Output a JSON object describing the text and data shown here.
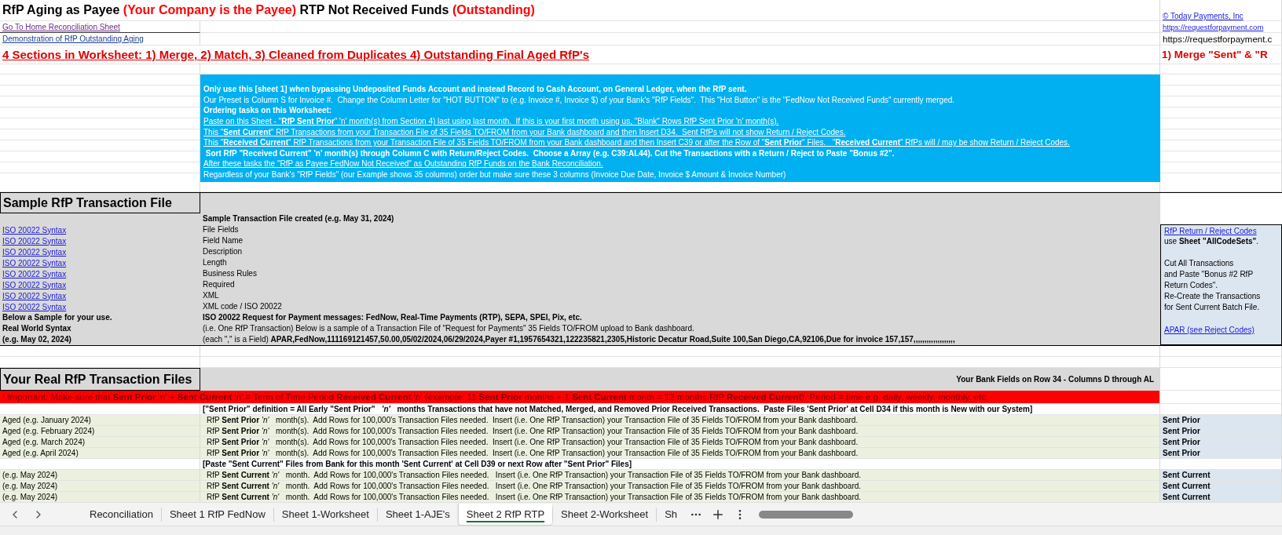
{
  "header": {
    "title": [
      {
        "text": "RfP Aging as Payee ",
        "color": "#000000"
      },
      {
        "text": "(Your Company is the Payee)",
        "color": "#ff0000"
      },
      {
        "text": " RTP Not Received Funds ",
        "color": "#000000"
      },
      {
        "text": "(Outstanding)",
        "color": "#ff0000"
      }
    ],
    "home_link": "Go To Home Reconciliation Sheet",
    "demo_link": "Demonstration of RfP Outstanding Aging",
    "sections_heading": "4 Sections in Worksheet: 1) Merge, 2) Match, 3) Cleaned from Duplicates 4) Outstanding Final Aged RfP's",
    "copyright_link": "© Today Payments, Inc",
    "site_link": "https://requestforpayment.com",
    "site_text": "https://requestforpayment.c",
    "merge_heading": "1) Merge \"Sent\" & \"R"
  },
  "instructions": [
    {
      "kind": "bold",
      "text": "Only use this [sheet 1] when bypassing Undeposited Funds Account and instead Record to Cash Account, on General Ledger, when the RfP sent."
    },
    {
      "kind": "plain",
      "text": "Our Preset is Column S for Invoice #.  Change the Column Letter for \"HOT BUTTON\" to (e.g. Invoice #, Invoice $) of your Bank's \"RfP Fields\".  This \"Hot Button\" is the \"FedNow Not Received Funds\" currently merged."
    },
    {
      "kind": "bold",
      "text": "Ordering tasks on this Worksheet:"
    },
    {
      "kind": "link",
      "text": "Paste on this Sheet - \"**RfP Sent Prior**\" 'n' month(s) from Section 4) last using last month.  If this is your first month using us, \"Blank\" Rows RfP Sent Prior 'n' month(s)."
    },
    {
      "kind": "link",
      "text": "This \"**Sent Current**\" RfP Transactions from your Transaction File of 35 Fields TO/FROM from your Bank dashboard and then Insert D34.  Sent RfPs will not show Return / Reject Codes."
    },
    {
      "kind": "link",
      "text": "This \"**Received Current**\" RfP Transactions from your Transaction File of 35 Fields TO/FROM from your Bank dashboard and then Insert C39 or after the Row of \"**Sent Prior**\" Files.   \"**Received Current**\" RfPs will / may be show Return / Reject Codes."
    },
    {
      "kind": "bold",
      "text": " Sort RfP \"Received Current\" 'n' month(s) through Column C with Return/Reject Codes.  Choose a Array (e.g. C39:AL44). Cut the Transactions with a Return / Reject to Paste \"Bonus #2\"."
    },
    {
      "kind": "link",
      "text": "After these tasks the \"RfP as Payee FedNow Not Received\" as Outstanding RfP Funds on the Bank Reconciliation."
    },
    {
      "kind": "plain",
      "text": "Regardless of your Bank's \"RfP Fields\" (our Example shows 35 columns) order but make sure these 3 columns (Invoice Due Date, Invoice $ Amount & Invoice Number)"
    }
  ],
  "sample": {
    "title": "Sample RfP Transaction File",
    "rows": [
      {
        "value": {
          "kind": "bold",
          "text": "Sample Transaction File created (e.g. May 31, 2024)"
        }
      },
      {
        "label": {
          "kind": "link",
          "text": "ISO 20022 Syntax"
        },
        "value": {
          "kind": "plain",
          "text": "File Fields"
        }
      },
      {
        "label": {
          "kind": "link",
          "text": "ISO 20022 Syntax"
        },
        "value": {
          "kind": "plain",
          "text": "Field Name"
        }
      },
      {
        "label": {
          "kind": "link",
          "text": "ISO 20022 Syntax"
        },
        "value": {
          "kind": "plain",
          "text": "Description"
        }
      },
      {
        "label": {
          "kind": "link",
          "text": "ISO 20022 Syntax"
        },
        "value": {
          "kind": "plain",
          "text": "Length"
        }
      },
      {
        "label": {
          "kind": "link",
          "text": "ISO 20022 Syntax"
        },
        "value": {
          "kind": "plain",
          "text": "Business Rules"
        }
      },
      {
        "label": {
          "kind": "link",
          "text": "ISO 20022 Syntax"
        },
        "value": {
          "kind": "plain",
          "text": "Required"
        }
      },
      {
        "label": {
          "kind": "link",
          "text": "ISO 20022 Syntax"
        },
        "value": {
          "kind": "plain",
          "text": "XML"
        }
      },
      {
        "label": {
          "kind": "link",
          "text": "ISO 20022 Syntax"
        },
        "value": {
          "kind": "plain",
          "text": "XML code / ISO 20022"
        }
      },
      {
        "label": {
          "kind": "bold",
          "text": "Below a Sample for your use."
        },
        "value": {
          "kind": "bold",
          "text": "ISO 20022 Request for Payment messages: FedNow, Real-Time Payments (RTP), SEPA, SPEI, Pix, etc."
        }
      },
      {
        "label": {
          "kind": "bold",
          "text": "Real World Syntax"
        },
        "value": {
          "kind": "plain",
          "text": "(i.e. One RfP Transaction) Below is a sample of a Transaction File of \"Request for Payments\" 35 Fields TO/FROM upload to Bank dashboard."
        }
      },
      {
        "label": {
          "kind": "bold",
          "text": "(e.g. May 02, 2024)"
        },
        "value": {
          "kind": "plain",
          "text": "(each \",\" is a Field) **APAR,FedNow,111169121457,50.00,05/02/2024,06/29/2024,Payer #1,1957654321,122235821,2305,Historic Decatur Road,Suite 100,San Diego,CA,92106,Due for invoice 157,157,,,,,,,,,,,,,,,,,,,**"
        }
      }
    ],
    "side": [
      {
        "kind": "link",
        "text": "RfP Return / Reject Codes"
      },
      {
        "kind": "plain",
        "text": "use **Sheet \"AllCodeSets\"**."
      },
      {
        "kind": "blank"
      },
      {
        "kind": "plain",
        "text": "Cut All Transactions"
      },
      {
        "kind": "plain",
        "text": "and Paste \"Bonus #2 RfP"
      },
      {
        "kind": "plain",
        "text": "Return Codes\"."
      },
      {
        "kind": "plain",
        "text": "Re-Create the Transactions"
      },
      {
        "kind": "plain",
        "text": "for Sent Current Batch File."
      },
      {
        "kind": "blank"
      },
      {
        "kind": "link",
        "text": "APAR (see Reject Codes)"
      }
    ]
  },
  "real": {
    "title": "Your Real RfP Transaction Files",
    "note": "Your Bank Fields on Row 34 - Columns D through AL",
    "rows": [
      {
        "kind": "important",
        "text": "! Important: Make sure that **Sent Prior** 'n' + **Sent Current** 'n' = Term of Time Period **Received Current** 'n' (example: 11 **Sent Prior** months + 1 **Sent Current** month = 12 months RfP **Received Current**). Period = time e.g. daily, weekly, monthly, etc."
      },
      {
        "kind": "note",
        "text": "[\"Sent Prior\" definition = All Early \"Sent Prior\"  *'n'*  months Transactions that have not Matched, Merged, and Removed Prior Received Transactions.  Paste Files 'Sent Prior' at Cell D34 if this month is New with our System]"
      },
      {
        "kind": "aged",
        "label": "Aged (e.g. January 2024)",
        "text": "RfP **Sent Prior** *'n'*  month(s).  Add Rows for 100,000's Transaction Files needed.  Insert (i.e. One RfP Transaction) your Transaction File of 35 Fields TO/FROM from your Bank dashboard.",
        "tag": "Sent Prior"
      },
      {
        "kind": "aged",
        "label": "Aged (e.g. February 2024)",
        "text": "RfP **Sent Prior** *'n'*  month(s).  Add Rows for 100,000's Transaction Files needed.  Insert (i.e. One RfP Transaction) your Transaction File of 35 Fields TO/FROM from your Bank dashboard.",
        "tag": "Sent Prior"
      },
      {
        "kind": "aged",
        "label": "Aged (e.g. March 2024)",
        "text": "RfP **Sent Prior** *'n'*  month(s).  Add Rows for 100,000's Transaction Files needed.  Insert (i.e. One RfP Transaction) your Transaction File of 35 Fields TO/FROM from your Bank dashboard.",
        "tag": "Sent Prior"
      },
      {
        "kind": "aged",
        "label": "Aged (e.g. April 2024)",
        "text": "RfP **Sent Prior** *'n'*  month(s).  Add Rows for 100,000's Transaction Files needed.  Insert (i.e. One RfP Transaction) your Transaction File of 35 Fields TO/FROM from your Bank dashboard.",
        "tag": "Sent Prior"
      },
      {
        "kind": "note",
        "text": "[Paste \"Sent Current\" Files from Bank for this month 'Sent Current' at Cell D39 or next Row after \"Sent Prior\" Files]"
      },
      {
        "kind": "aged",
        "label": "(e.g. May 2024)",
        "text": "RfP **Sent Current** *'n'*  month.  Add Rows for 100,000's Transaction Files needed.   Insert (i.e. One RfP Transaction) your Transaction File of 35 Fields TO/FROM from your Bank dashboard.",
        "tag": "Sent Current"
      },
      {
        "kind": "aged",
        "label": "(e.g. May 2024)",
        "text": "RfP **Sent Current** *'n'*  month.  Add Rows for 100,000's Transaction Files needed.   Insert (i.e. One RfP Transaction) your Transaction File of 35 Fields TO/FROM from your Bank dashboard.",
        "tag": "Sent Current"
      },
      {
        "kind": "aged",
        "label": "(e.g. May 2024)",
        "text": "RfP **Sent Current** *'n'*  month.  Add Rows for 100,000's Transaction Files needed.   Insert (i.e. One RfP Transaction) your Transaction File of 35 Fields TO/FROM from your Bank dashboard.",
        "tag": "Sent Current"
      }
    ]
  },
  "sheet_tabs": [
    {
      "label": "Reconciliation",
      "selected": false
    },
    {
      "label": "Sheet 1 RfP FedNow",
      "selected": false
    },
    {
      "label": "Sheet 1-Worksheet",
      "selected": false
    },
    {
      "label": "Sheet 1-AJE's",
      "selected": false
    },
    {
      "label": "Sheet 2 RfP RTP",
      "selected": true
    },
    {
      "label": "Sheet 2-Worksheet",
      "selected": false
    },
    {
      "label": "Sh",
      "selected": false
    }
  ]
}
